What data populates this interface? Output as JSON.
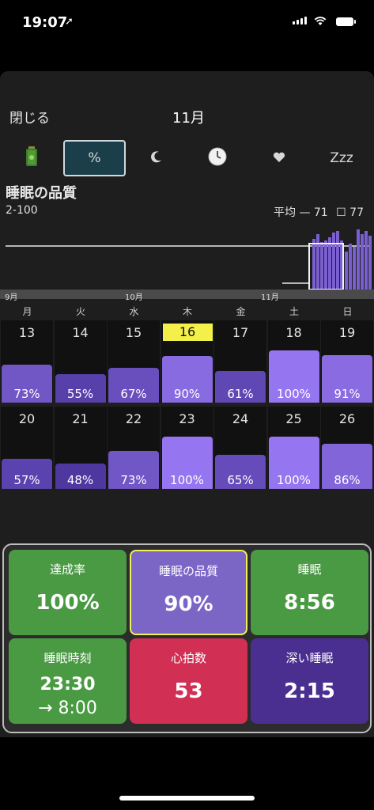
{
  "status": {
    "time": "19:07"
  },
  "header": {
    "close_label": "閉じる",
    "month_label": "11月"
  },
  "tabs": [
    {
      "name": "battery",
      "label": ""
    },
    {
      "name": "percent",
      "label": "%"
    },
    {
      "name": "moon",
      "label": ""
    },
    {
      "name": "clock",
      "label": ""
    },
    {
      "name": "heart",
      "label": ""
    },
    {
      "name": "zzz",
      "label": "Zzz"
    }
  ],
  "chart": {
    "title": "睡眠の品質",
    "range": "2-100",
    "legend_avg": "平均 — 71",
    "legend_sel": "☐ 77",
    "timeline_labels": [
      "9月",
      "10月",
      "11月"
    ]
  },
  "chart_data": {
    "type": "bar",
    "title": "睡眠の品質",
    "ylim": [
      2,
      100
    ],
    "average": 71,
    "selected_average": 77
  },
  "weekdays": [
    "月",
    "火",
    "水",
    "木",
    "金",
    "土",
    "日"
  ],
  "calendar": [
    [
      {
        "day": "13",
        "pct": "73%",
        "v": 73
      },
      {
        "day": "14",
        "pct": "55%",
        "v": 55
      },
      {
        "day": "15",
        "pct": "67%",
        "v": 67
      },
      {
        "day": "16",
        "pct": "90%",
        "v": 90,
        "today": true
      },
      {
        "day": "17",
        "pct": "61%",
        "v": 61
      },
      {
        "day": "18",
        "pct": "100%",
        "v": 100
      },
      {
        "day": "19",
        "pct": "91%",
        "v": 91
      }
    ],
    [
      {
        "day": "20",
        "pct": "57%",
        "v": 57
      },
      {
        "day": "21",
        "pct": "48%",
        "v": 48
      },
      {
        "day": "22",
        "pct": "73%",
        "v": 73
      },
      {
        "day": "23",
        "pct": "100%",
        "v": 100
      },
      {
        "day": "24",
        "pct": "65%",
        "v": 65
      },
      {
        "day": "25",
        "pct": "100%",
        "v": 100
      },
      {
        "day": "26",
        "pct": "86%",
        "v": 86
      }
    ]
  ],
  "summary": [
    {
      "label": "達成率",
      "value": "100%",
      "color": "#4a9a44",
      "selected": false
    },
    {
      "label": "睡眠の品質",
      "value": "90%",
      "color": "#7b66c6",
      "selected": true
    },
    {
      "label": "睡眠",
      "value": "8:56",
      "color": "#4a9a44",
      "selected": false
    },
    {
      "label": "睡眠時刻",
      "value": "23:30",
      "value2": "→ 8:00",
      "color": "#4a9a44",
      "selected": false
    },
    {
      "label": "心拍数",
      "value": "53",
      "color": "#d22f55",
      "selected": false
    },
    {
      "label": "深い睡眠",
      "value": "2:15",
      "color": "#4a2f91",
      "selected": false
    }
  ]
}
